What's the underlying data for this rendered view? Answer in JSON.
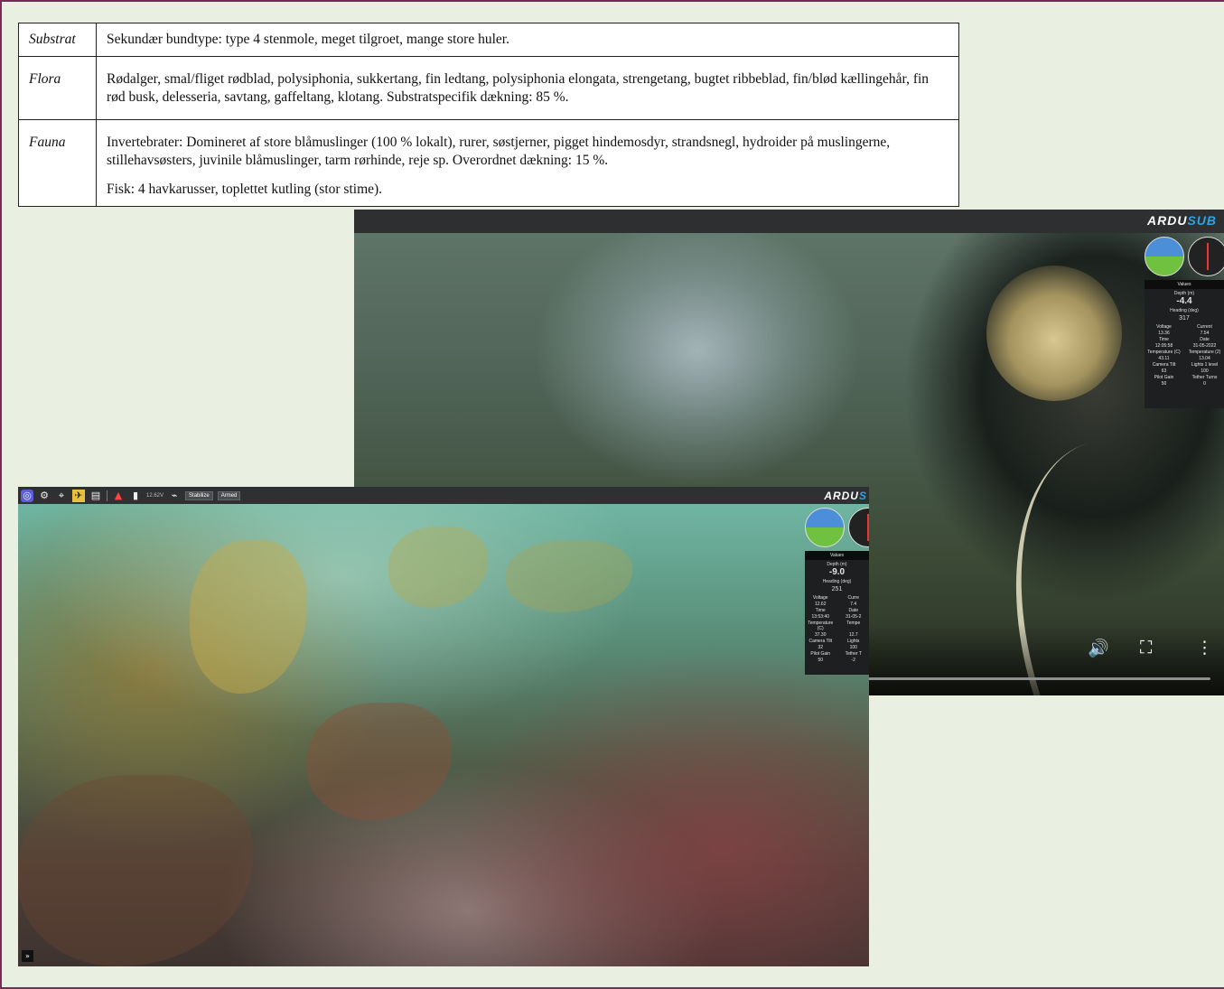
{
  "survey_table": {
    "rows": [
      {
        "label": "Substrat",
        "paragraphs": [
          "Sekundær bundtype: type 4 stenmole, meget tilgroet, mange store huler."
        ]
      },
      {
        "label": "Flora",
        "paragraphs": [
          "Rødalger, smal/fliget rødblad, polysiphonia, sukkertang, fin ledtang, polysiphonia elongata, strengetang, bugtet ribbeblad, fin/blød kællingehår, fin rød busk, delesseria, savtang, gaffeltang, klotang. Substratspecifik dækning: 85 %."
        ]
      },
      {
        "label": "Fauna",
        "paragraphs": [
          "Invertebrater: Domineret af store blåmuslinger (100 % lokalt), rurer, søstjerner, pigget hindemosdyr, strandsnegl, hydroider på muslingerne, stillehavsøsters, juvinile blåmuslinger, tarm rørhinde, reje sp. Overordnet dækning: 15 %.",
          "Fisk: 4 havkarusser, toplettet kutling (stor stime)."
        ]
      }
    ]
  },
  "video_top": {
    "logo_a": "ARDU",
    "logo_b": "SUB",
    "values_panel": {
      "header": "Values",
      "depth_label": "Depth (m)",
      "depth_value": "-4.4",
      "heading_label": "Heading (deg)",
      "heading_value": "317",
      "cells": [
        "Voltage",
        "Current",
        "13.36",
        "7.54",
        "Time",
        "Date",
        "12:05:58",
        "31-05-2022",
        "Temperature (C)",
        "Temperature (2)",
        "43.11",
        "13.04",
        "Camera Tilt",
        "Lights 1 level",
        "63",
        "100",
        "Pilot Gain",
        "Tether Turns",
        "50",
        "0"
      ]
    },
    "controls": {
      "volume_icon": "🔊",
      "fullscreen_icon": "⛶",
      "more_icon": "⋮"
    }
  },
  "video_bottom": {
    "toolbar": {
      "voltage": "12.62V",
      "mode": "Stabilize",
      "arm_state": "Armed"
    },
    "logo_a": "ARDU",
    "logo_b": "S",
    "values_panel": {
      "header": "Values",
      "depth_label": "Depth (m)",
      "depth_value": "-9.0",
      "heading_label": "Heading (deg)",
      "heading_value": "251",
      "cells": [
        "Voltage",
        "Curre",
        "12.62",
        "7.4",
        "Time",
        "Date",
        "13:53:40",
        "31-05-2",
        "Temperature (C)",
        "Tempe",
        "37.30",
        "12.7",
        "Camera Tilt",
        "Lights",
        "32",
        "100",
        "Pilot Gain",
        "Tether T",
        "50",
        "-2"
      ]
    },
    "expand_icon": "»"
  }
}
